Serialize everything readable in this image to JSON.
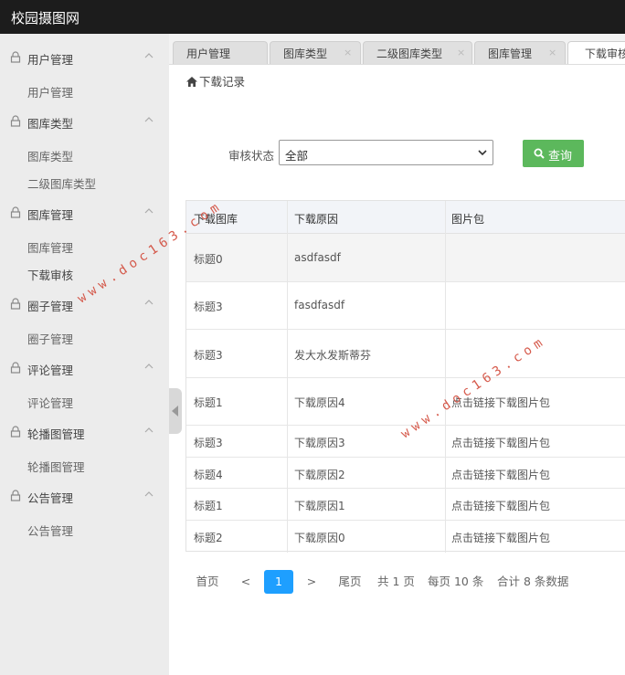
{
  "app": {
    "title": "校园摄图网"
  },
  "sidebar": {
    "groups": [
      {
        "label": "用户管理",
        "items": [
          "用户管理"
        ]
      },
      {
        "label": "图库类型",
        "items": [
          "图库类型",
          "二级图库类型"
        ]
      },
      {
        "label": "图库管理",
        "items": [
          "图库管理",
          "下载审核"
        ]
      },
      {
        "label": "圈子管理",
        "items": [
          "圈子管理"
        ]
      },
      {
        "label": "评论管理",
        "items": [
          "评论管理"
        ]
      },
      {
        "label": "轮播图管理",
        "items": [
          "轮播图管理"
        ]
      },
      {
        "label": "公告管理",
        "items": [
          "公告管理"
        ]
      }
    ]
  },
  "tabs": [
    {
      "label": "用户管理"
    },
    {
      "label": "图库类型"
    },
    {
      "label": "二级图库类型"
    },
    {
      "label": "图库管理"
    },
    {
      "label": "下载审核"
    }
  ],
  "tab_close_glyph": "×",
  "breadcrumb": {
    "label": "下载记录"
  },
  "filter": {
    "label": "审核状态",
    "selected": "全部"
  },
  "query_button": {
    "label": "查询"
  },
  "table": {
    "headers": [
      "下载图库",
      "下载原因",
      "图片包"
    ],
    "rows": [
      [
        "标题0",
        "asdfasdf",
        ""
      ],
      [
        "标题3",
        "fasdfasdf",
        ""
      ],
      [
        "标题3",
        "发大水发斯蒂芬",
        ""
      ],
      [
        "标题1",
        "下载原因4",
        "点击链接下载图片包"
      ],
      [
        "标题3",
        "下载原因3",
        "点击链接下载图片包"
      ],
      [
        "标题4",
        "下载原因2",
        "点击链接下载图片包"
      ],
      [
        "标题1",
        "下载原因1",
        "点击链接下载图片包"
      ],
      [
        "标题2",
        "下载原因0",
        "点击链接下载图片包"
      ]
    ]
  },
  "pagination": {
    "first": "首页",
    "prev": "<",
    "current": "1",
    "next": ">",
    "last": "尾页",
    "total_pages": "共 1 页",
    "per_page": "每页 10 条",
    "total_records": "合计 8 条数据"
  },
  "watermarks": [
    "www.doc163.com",
    "www.doc163.com"
  ],
  "colors": {
    "topbar": "#1c1c1c",
    "sidebar": "#ececec",
    "primary_button": "#5cb85c",
    "current_page": "#1e9fff",
    "watermark": "#d24a3a"
  }
}
